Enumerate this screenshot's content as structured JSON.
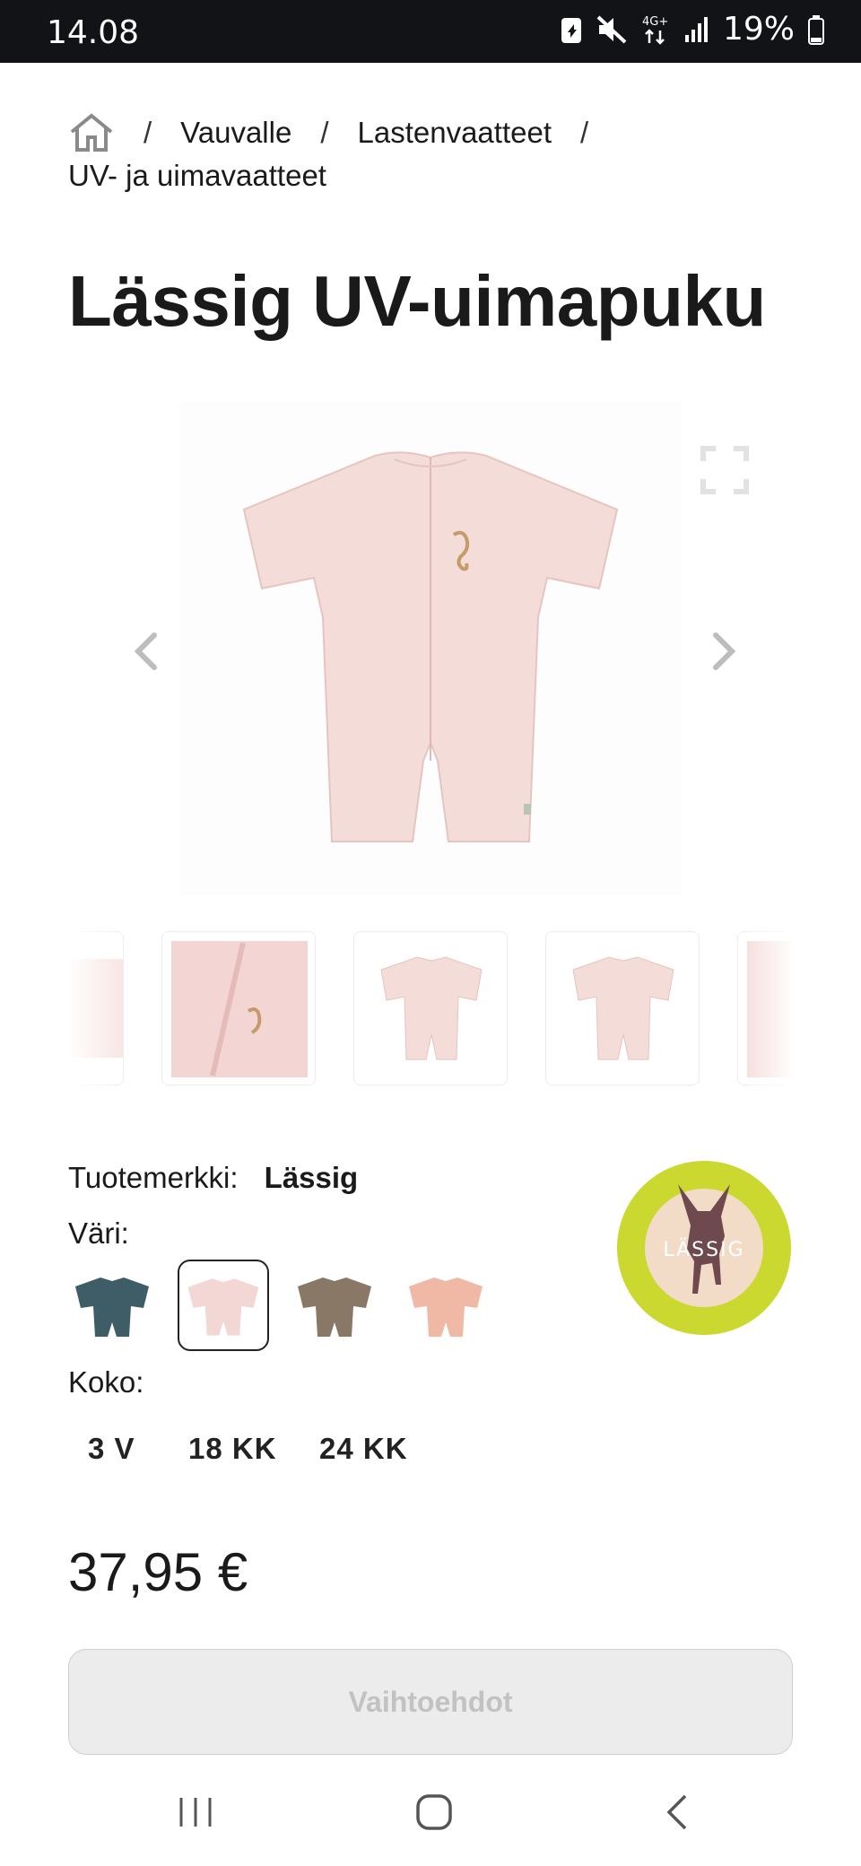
{
  "status_bar": {
    "time": "14.08",
    "network": "4G+",
    "battery": "19%"
  },
  "breadcrumb": {
    "home_icon": "home-icon",
    "items": [
      "Vauvalle",
      "Lastenvaatteet",
      "UV- ja uimavaatteet"
    ],
    "separator": "/"
  },
  "product": {
    "title": "Lässig UV-uimapuku",
    "brand_label": "Tuotemerkki:",
    "brand_value": "Lässig",
    "color_label": "Väri:",
    "colors": [
      {
        "name": "petrol",
        "hex": "#3f5d66",
        "selected": false
      },
      {
        "name": "light-pink",
        "hex": "#f3d7d4",
        "selected": true
      },
      {
        "name": "olive-brown",
        "hex": "#8a7866",
        "selected": false
      },
      {
        "name": "peach",
        "hex": "#f0b9a6",
        "selected": false
      }
    ],
    "size_label": "Koko:",
    "sizes": [
      "3 V",
      "18 KK",
      "24 KK"
    ],
    "price": "37,95 €",
    "options_button": "Vaihtoehdot",
    "logo_text": "LÄSSIG"
  },
  "gallery": {
    "product_color": "#f4dcd9",
    "icons": [
      "chevron-left-icon",
      "chevron-right-icon",
      "fullscreen-icon"
    ]
  },
  "nav_bar": {
    "icons": [
      "recent-apps-icon",
      "home-button-icon",
      "back-icon"
    ]
  }
}
